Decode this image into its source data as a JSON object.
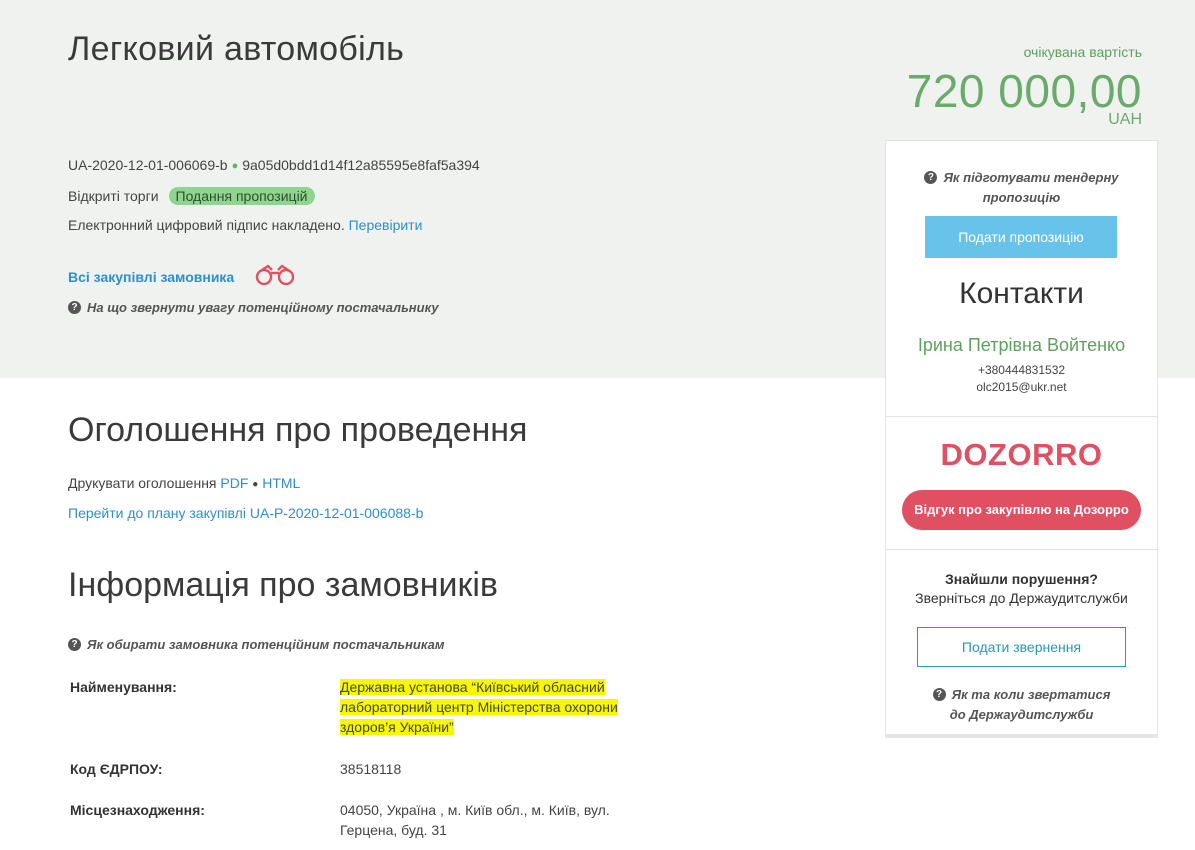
{
  "header": {
    "title": "Легковий автомобіль",
    "tender_id": "UA-2020-12-01-006069-b",
    "hash": "9a05d0bdd1d14f12a85595e8faf5a394",
    "procedure": "Відкриті торги",
    "status": "Подання пропозицій",
    "signature_text": "Електронний цифровий підпис накладено.",
    "signature_link": "Перевірити",
    "all_purchases_link": "Всі закупівлі замовника",
    "supplier_hint": "На що звернути увагу потенційному постачальнику"
  },
  "price": {
    "caption": "очікувана вартість",
    "value": "720 000,00",
    "currency": "UAH"
  },
  "announcement": {
    "title": "Оголошення про проведення",
    "print_label": "Друкувати оголошення",
    "pdf": "PDF",
    "html": "HTML",
    "plan_link": "Перейти до плану закупівлі UA-P-2020-12-01-006088-b"
  },
  "customers": {
    "title": "Інформація про замовників",
    "hint": "Як обирати замовника потенційним постачальникам",
    "rows": [
      {
        "label": "Найменування:",
        "value_lines": [
          "Державна установа “Київський обласний",
          "лабораторний центр Міністерства охорони",
          "здоров’я України”"
        ]
      },
      {
        "label": "Код ЄДРПОУ:",
        "value_lines": [
          "38518118"
        ]
      },
      {
        "label": "Місцезнаходження:",
        "value_lines": [
          "04050, Україна , м. Київ обл., м. Київ, вул.",
          "Герцена, буд. 31"
        ]
      }
    ]
  },
  "sidebar": {
    "tender_hint_line1": "Як підготувати тендерну",
    "tender_hint_line2": "пропозицію",
    "submit_button": "Подати пропозицію",
    "contacts_title": "Контакти",
    "contact_name": "Ірина Петрівна Войтенко",
    "phone": "+380444831532",
    "email": "olc2015@ukr.net",
    "dozorro_logo": "DOZORRO",
    "dozorro_button": "Відгук про закупівлю на Дозорро",
    "violation_title": "Знайшли порушення?",
    "violation_text": "Зверніться до Держаудитслужби",
    "appeal_button": "Подати звернення",
    "audit_hint_line1": "Як та коли звертатися",
    "audit_hint_line2": "до Держаудитслужби"
  },
  "colors": {
    "hero_bg": "#eff2ef",
    "accent_green": "#6aaa6a",
    "link_blue": "#2f8fc7",
    "button_blue": "#68c3ea",
    "dozorro_red": "#e04f62",
    "highlight": "#f7f700"
  }
}
